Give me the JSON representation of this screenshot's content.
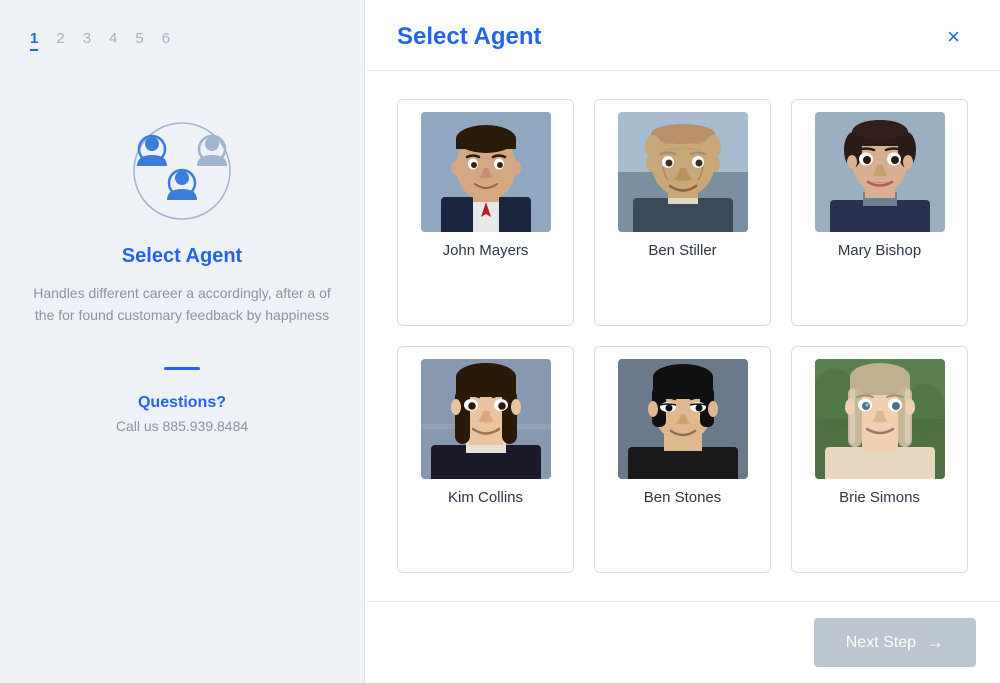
{
  "sidebar": {
    "steps": [
      "1",
      "2",
      "3",
      "4",
      "5",
      "6"
    ],
    "active_step": 0,
    "title": "Select Agent",
    "description": "Handles different career a accordingly, after a of the for found customary feedback by happiness",
    "questions_label": "Questions?",
    "phone": "Call us 885.939.8484"
  },
  "header": {
    "title": "Select Agent",
    "close_label": "×"
  },
  "agents": [
    {
      "name": "John Mayers",
      "id": "john-mayers",
      "photo_class": "photo-bg-1"
    },
    {
      "name": "Ben Stiller",
      "id": "ben-stiller",
      "photo_class": "photo-bg-2"
    },
    {
      "name": "Mary Bishop",
      "id": "mary-bishop",
      "photo_class": "photo-bg-3"
    },
    {
      "name": "Kim Collins",
      "id": "kim-collins",
      "photo_class": "photo-bg-4"
    },
    {
      "name": "Ben Stones",
      "id": "ben-stones",
      "photo_class": "photo-bg-5"
    },
    {
      "name": "Brie Simons",
      "id": "brie-simons",
      "photo_class": "photo-bg-6"
    }
  ],
  "footer": {
    "next_step_label": "Next Step",
    "arrow": "→"
  }
}
